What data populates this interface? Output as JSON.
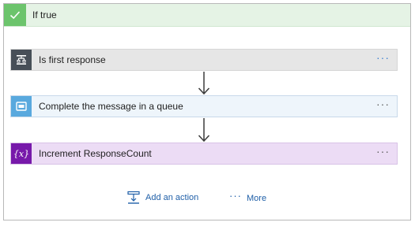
{
  "branch": {
    "title": "If true",
    "header_icon": "checkmark-icon",
    "header_color": "#e5f3e5",
    "accent_color": "#6cc46c"
  },
  "steps": [
    {
      "label": "Is first response",
      "icon": "condition-icon",
      "color": "#484f58",
      "menu": "···"
    },
    {
      "label": "Complete the message in a queue",
      "icon": "queue-icon",
      "color": "#59a9de",
      "menu": "···"
    },
    {
      "label": "Increment ResponseCount",
      "icon": "variable-icon",
      "icon_text": "{x}",
      "color": "#7719aa",
      "menu": "···"
    }
  ],
  "footer": {
    "add_action_label": "Add an action",
    "add_action_icon": "add-action-icon",
    "more_label": "More",
    "more_dots": "···",
    "link_color": "#1f5fa8"
  }
}
